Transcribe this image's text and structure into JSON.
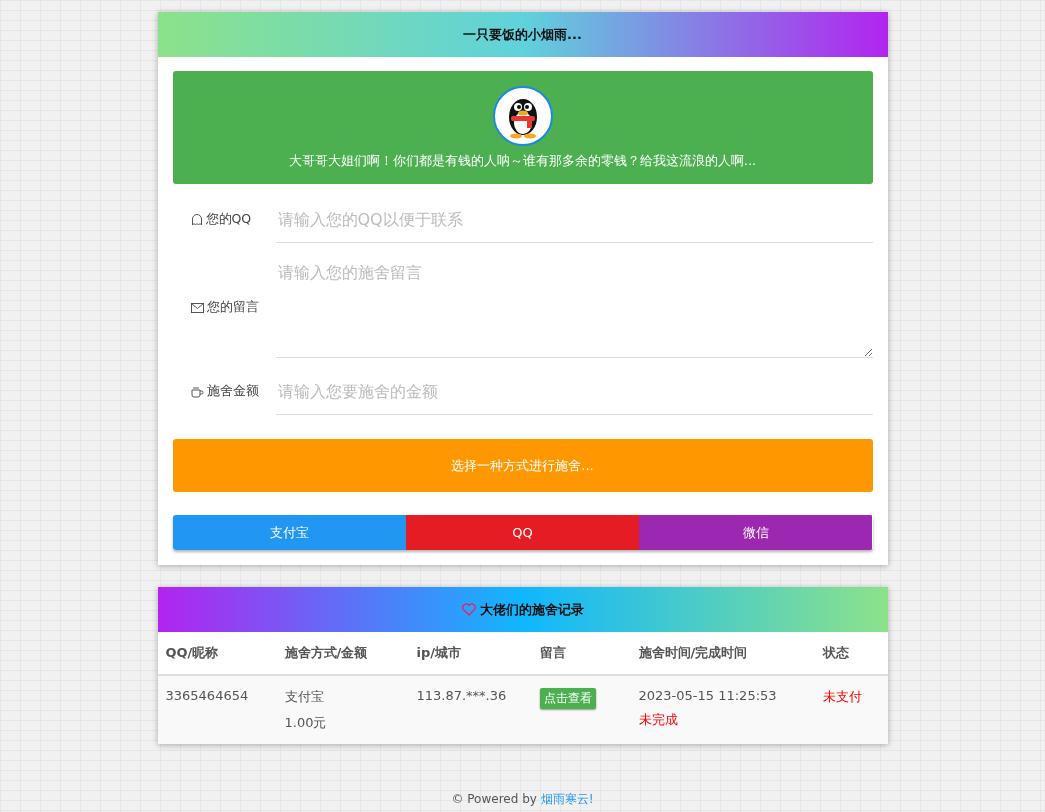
{
  "donate_card": {
    "title": "一只要饭的小烟雨...",
    "banner_text": "大哥哥大姐们啊！你们都是有钱的人呐～谁有那多余的零钱？给我这流浪的人啊...",
    "fields": [
      {
        "kind": "input",
        "label": "您的QQ",
        "placeholder": "请输入您的QQ以便于联系"
      },
      {
        "kind": "textarea",
        "label": "您的留言",
        "placeholder": "请输入您的施舍留言"
      },
      {
        "kind": "amount",
        "label": "施舍金额",
        "placeholder": "请输入您要施舍的金额"
      }
    ],
    "prompt": "选择一种方式进行施舍...",
    "pay_buttons": [
      {
        "label": "支付宝",
        "color": "#2196f3"
      },
      {
        "label": "QQ",
        "color": "#e51c23"
      },
      {
        "label": "微信",
        "color": "#9c27b0"
      }
    ]
  },
  "records_card": {
    "title": "大佬们的施舍记录",
    "columns": [
      "QQ/昵称",
      "施舍方式/金额",
      "ip/城市",
      "留言",
      "施舍时间/完成时间",
      "状态"
    ],
    "rows": [
      {
        "qq": "3365464654",
        "method": "支付宝",
        "amount": "1.00元",
        "ip": "113.87.***.36",
        "message_button": "点击查看",
        "time": "2023-05-15 11:25:53",
        "completion": "未完成",
        "status": "未支付"
      }
    ]
  },
  "footer": {
    "text": "© Powered by ",
    "link": "烟雨寒云!"
  }
}
